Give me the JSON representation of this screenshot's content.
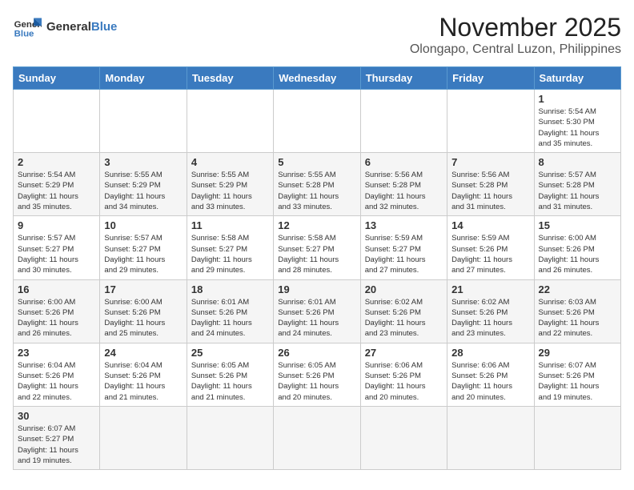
{
  "header": {
    "logo_line1": "General",
    "logo_line2": "Blue",
    "month": "November 2025",
    "location": "Olongapo, Central Luzon, Philippines"
  },
  "weekdays": [
    "Sunday",
    "Monday",
    "Tuesday",
    "Wednesday",
    "Thursday",
    "Friday",
    "Saturday"
  ],
  "weeks": [
    [
      {
        "day": "",
        "info": ""
      },
      {
        "day": "",
        "info": ""
      },
      {
        "day": "",
        "info": ""
      },
      {
        "day": "",
        "info": ""
      },
      {
        "day": "",
        "info": ""
      },
      {
        "day": "",
        "info": ""
      },
      {
        "day": "1",
        "info": "Sunrise: 5:54 AM\nSunset: 5:30 PM\nDaylight: 11 hours\nand 35 minutes."
      }
    ],
    [
      {
        "day": "2",
        "info": "Sunrise: 5:54 AM\nSunset: 5:29 PM\nDaylight: 11 hours\nand 35 minutes."
      },
      {
        "day": "3",
        "info": "Sunrise: 5:55 AM\nSunset: 5:29 PM\nDaylight: 11 hours\nand 34 minutes."
      },
      {
        "day": "4",
        "info": "Sunrise: 5:55 AM\nSunset: 5:29 PM\nDaylight: 11 hours\nand 33 minutes."
      },
      {
        "day": "5",
        "info": "Sunrise: 5:55 AM\nSunset: 5:28 PM\nDaylight: 11 hours\nand 33 minutes."
      },
      {
        "day": "6",
        "info": "Sunrise: 5:56 AM\nSunset: 5:28 PM\nDaylight: 11 hours\nand 32 minutes."
      },
      {
        "day": "7",
        "info": "Sunrise: 5:56 AM\nSunset: 5:28 PM\nDaylight: 11 hours\nand 31 minutes."
      },
      {
        "day": "8",
        "info": "Sunrise: 5:57 AM\nSunset: 5:28 PM\nDaylight: 11 hours\nand 31 minutes."
      }
    ],
    [
      {
        "day": "9",
        "info": "Sunrise: 5:57 AM\nSunset: 5:27 PM\nDaylight: 11 hours\nand 30 minutes."
      },
      {
        "day": "10",
        "info": "Sunrise: 5:57 AM\nSunset: 5:27 PM\nDaylight: 11 hours\nand 29 minutes."
      },
      {
        "day": "11",
        "info": "Sunrise: 5:58 AM\nSunset: 5:27 PM\nDaylight: 11 hours\nand 29 minutes."
      },
      {
        "day": "12",
        "info": "Sunrise: 5:58 AM\nSunset: 5:27 PM\nDaylight: 11 hours\nand 28 minutes."
      },
      {
        "day": "13",
        "info": "Sunrise: 5:59 AM\nSunset: 5:27 PM\nDaylight: 11 hours\nand 27 minutes."
      },
      {
        "day": "14",
        "info": "Sunrise: 5:59 AM\nSunset: 5:26 PM\nDaylight: 11 hours\nand 27 minutes."
      },
      {
        "day": "15",
        "info": "Sunrise: 6:00 AM\nSunset: 5:26 PM\nDaylight: 11 hours\nand 26 minutes."
      }
    ],
    [
      {
        "day": "16",
        "info": "Sunrise: 6:00 AM\nSunset: 5:26 PM\nDaylight: 11 hours\nand 26 minutes."
      },
      {
        "day": "17",
        "info": "Sunrise: 6:00 AM\nSunset: 5:26 PM\nDaylight: 11 hours\nand 25 minutes."
      },
      {
        "day": "18",
        "info": "Sunrise: 6:01 AM\nSunset: 5:26 PM\nDaylight: 11 hours\nand 24 minutes."
      },
      {
        "day": "19",
        "info": "Sunrise: 6:01 AM\nSunset: 5:26 PM\nDaylight: 11 hours\nand 24 minutes."
      },
      {
        "day": "20",
        "info": "Sunrise: 6:02 AM\nSunset: 5:26 PM\nDaylight: 11 hours\nand 23 minutes."
      },
      {
        "day": "21",
        "info": "Sunrise: 6:02 AM\nSunset: 5:26 PM\nDaylight: 11 hours\nand 23 minutes."
      },
      {
        "day": "22",
        "info": "Sunrise: 6:03 AM\nSunset: 5:26 PM\nDaylight: 11 hours\nand 22 minutes."
      }
    ],
    [
      {
        "day": "23",
        "info": "Sunrise: 6:04 AM\nSunset: 5:26 PM\nDaylight: 11 hours\nand 22 minutes."
      },
      {
        "day": "24",
        "info": "Sunrise: 6:04 AM\nSunset: 5:26 PM\nDaylight: 11 hours\nand 21 minutes."
      },
      {
        "day": "25",
        "info": "Sunrise: 6:05 AM\nSunset: 5:26 PM\nDaylight: 11 hours\nand 21 minutes."
      },
      {
        "day": "26",
        "info": "Sunrise: 6:05 AM\nSunset: 5:26 PM\nDaylight: 11 hours\nand 20 minutes."
      },
      {
        "day": "27",
        "info": "Sunrise: 6:06 AM\nSunset: 5:26 PM\nDaylight: 11 hours\nand 20 minutes."
      },
      {
        "day": "28",
        "info": "Sunrise: 6:06 AM\nSunset: 5:26 PM\nDaylight: 11 hours\nand 20 minutes."
      },
      {
        "day": "29",
        "info": "Sunrise: 6:07 AM\nSunset: 5:26 PM\nDaylight: 11 hours\nand 19 minutes."
      }
    ],
    [
      {
        "day": "30",
        "info": "Sunrise: 6:07 AM\nSunset: 5:27 PM\nDaylight: 11 hours\nand 19 minutes."
      },
      {
        "day": "",
        "info": ""
      },
      {
        "day": "",
        "info": ""
      },
      {
        "day": "",
        "info": ""
      },
      {
        "day": "",
        "info": ""
      },
      {
        "day": "",
        "info": ""
      },
      {
        "day": "",
        "info": ""
      }
    ]
  ]
}
